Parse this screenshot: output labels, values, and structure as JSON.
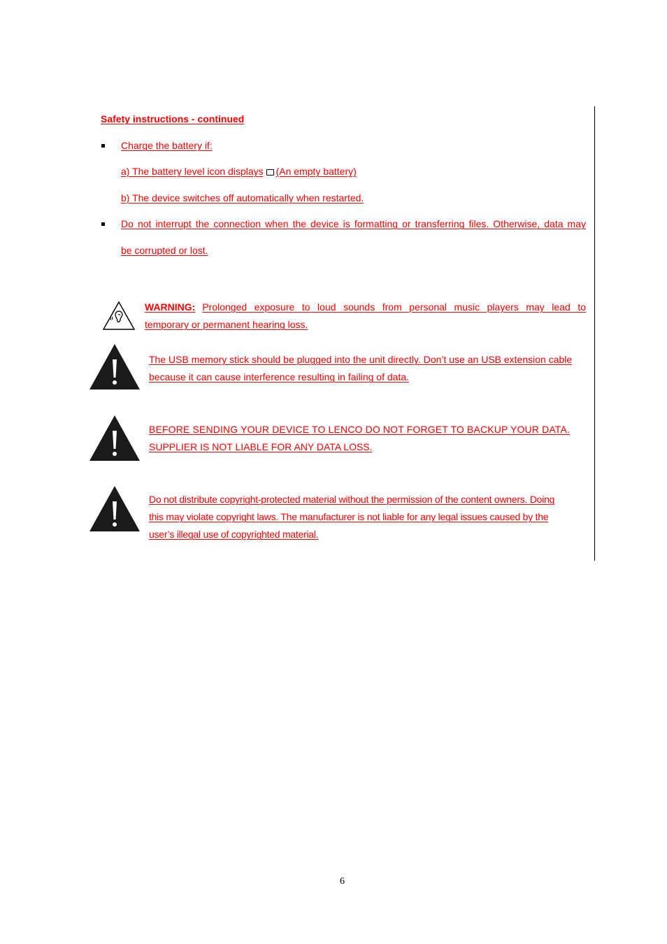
{
  "heading": "Safety instructions - continued",
  "bullets": [
    {
      "text": "Charge the battery if:",
      "sub_items": [
        {
          "prefix": "a) The battery level icon displays",
          "icon": "empty-battery-icon",
          "suffix": "(An empty battery)"
        },
        {
          "text": "b) The device switches off automatically when restarted."
        }
      ]
    },
    {
      "line1": "Do not interrupt the connection when the device is formatting or transferring files. Otherwise, data may",
      "line2": "be corrupted or lost."
    }
  ],
  "warnings": [
    {
      "icon": "hearing-warning-icon",
      "label": "WARNING:",
      "line1": "Prolonged exposure to loud sounds from personal music players may lead to",
      "line2": "temporary or permanent hearing loss."
    },
    {
      "icon": "exclamation-triangle-icon",
      "line1": "The USB memory stick should be plugged into the unit directly. Don’t use an USB extension cable",
      "line2": "because it can cause interference resulting in failing of data."
    },
    {
      "icon": "exclamation-triangle-icon",
      "line1": "BEFORE SENDING YOUR DEVICE TO LENCO DO NOT FORGET TO BACKUP YOUR DATA.",
      "line2": "SUPPLIER IS NOT LIABLE FOR ANY DATA LOSS."
    },
    {
      "icon": "exclamation-triangle-icon",
      "line1": "Do not distribute copyright-protected material without the permission of the content owners. Doing",
      "line2": "this may violate copyright laws. The manufacturer is not liable for any legal issues caused by the",
      "line3": "user’s illegal use of copyrighted material."
    }
  ],
  "page_number": "6",
  "colors": {
    "text": "#ff0000",
    "icon": "#000000"
  }
}
